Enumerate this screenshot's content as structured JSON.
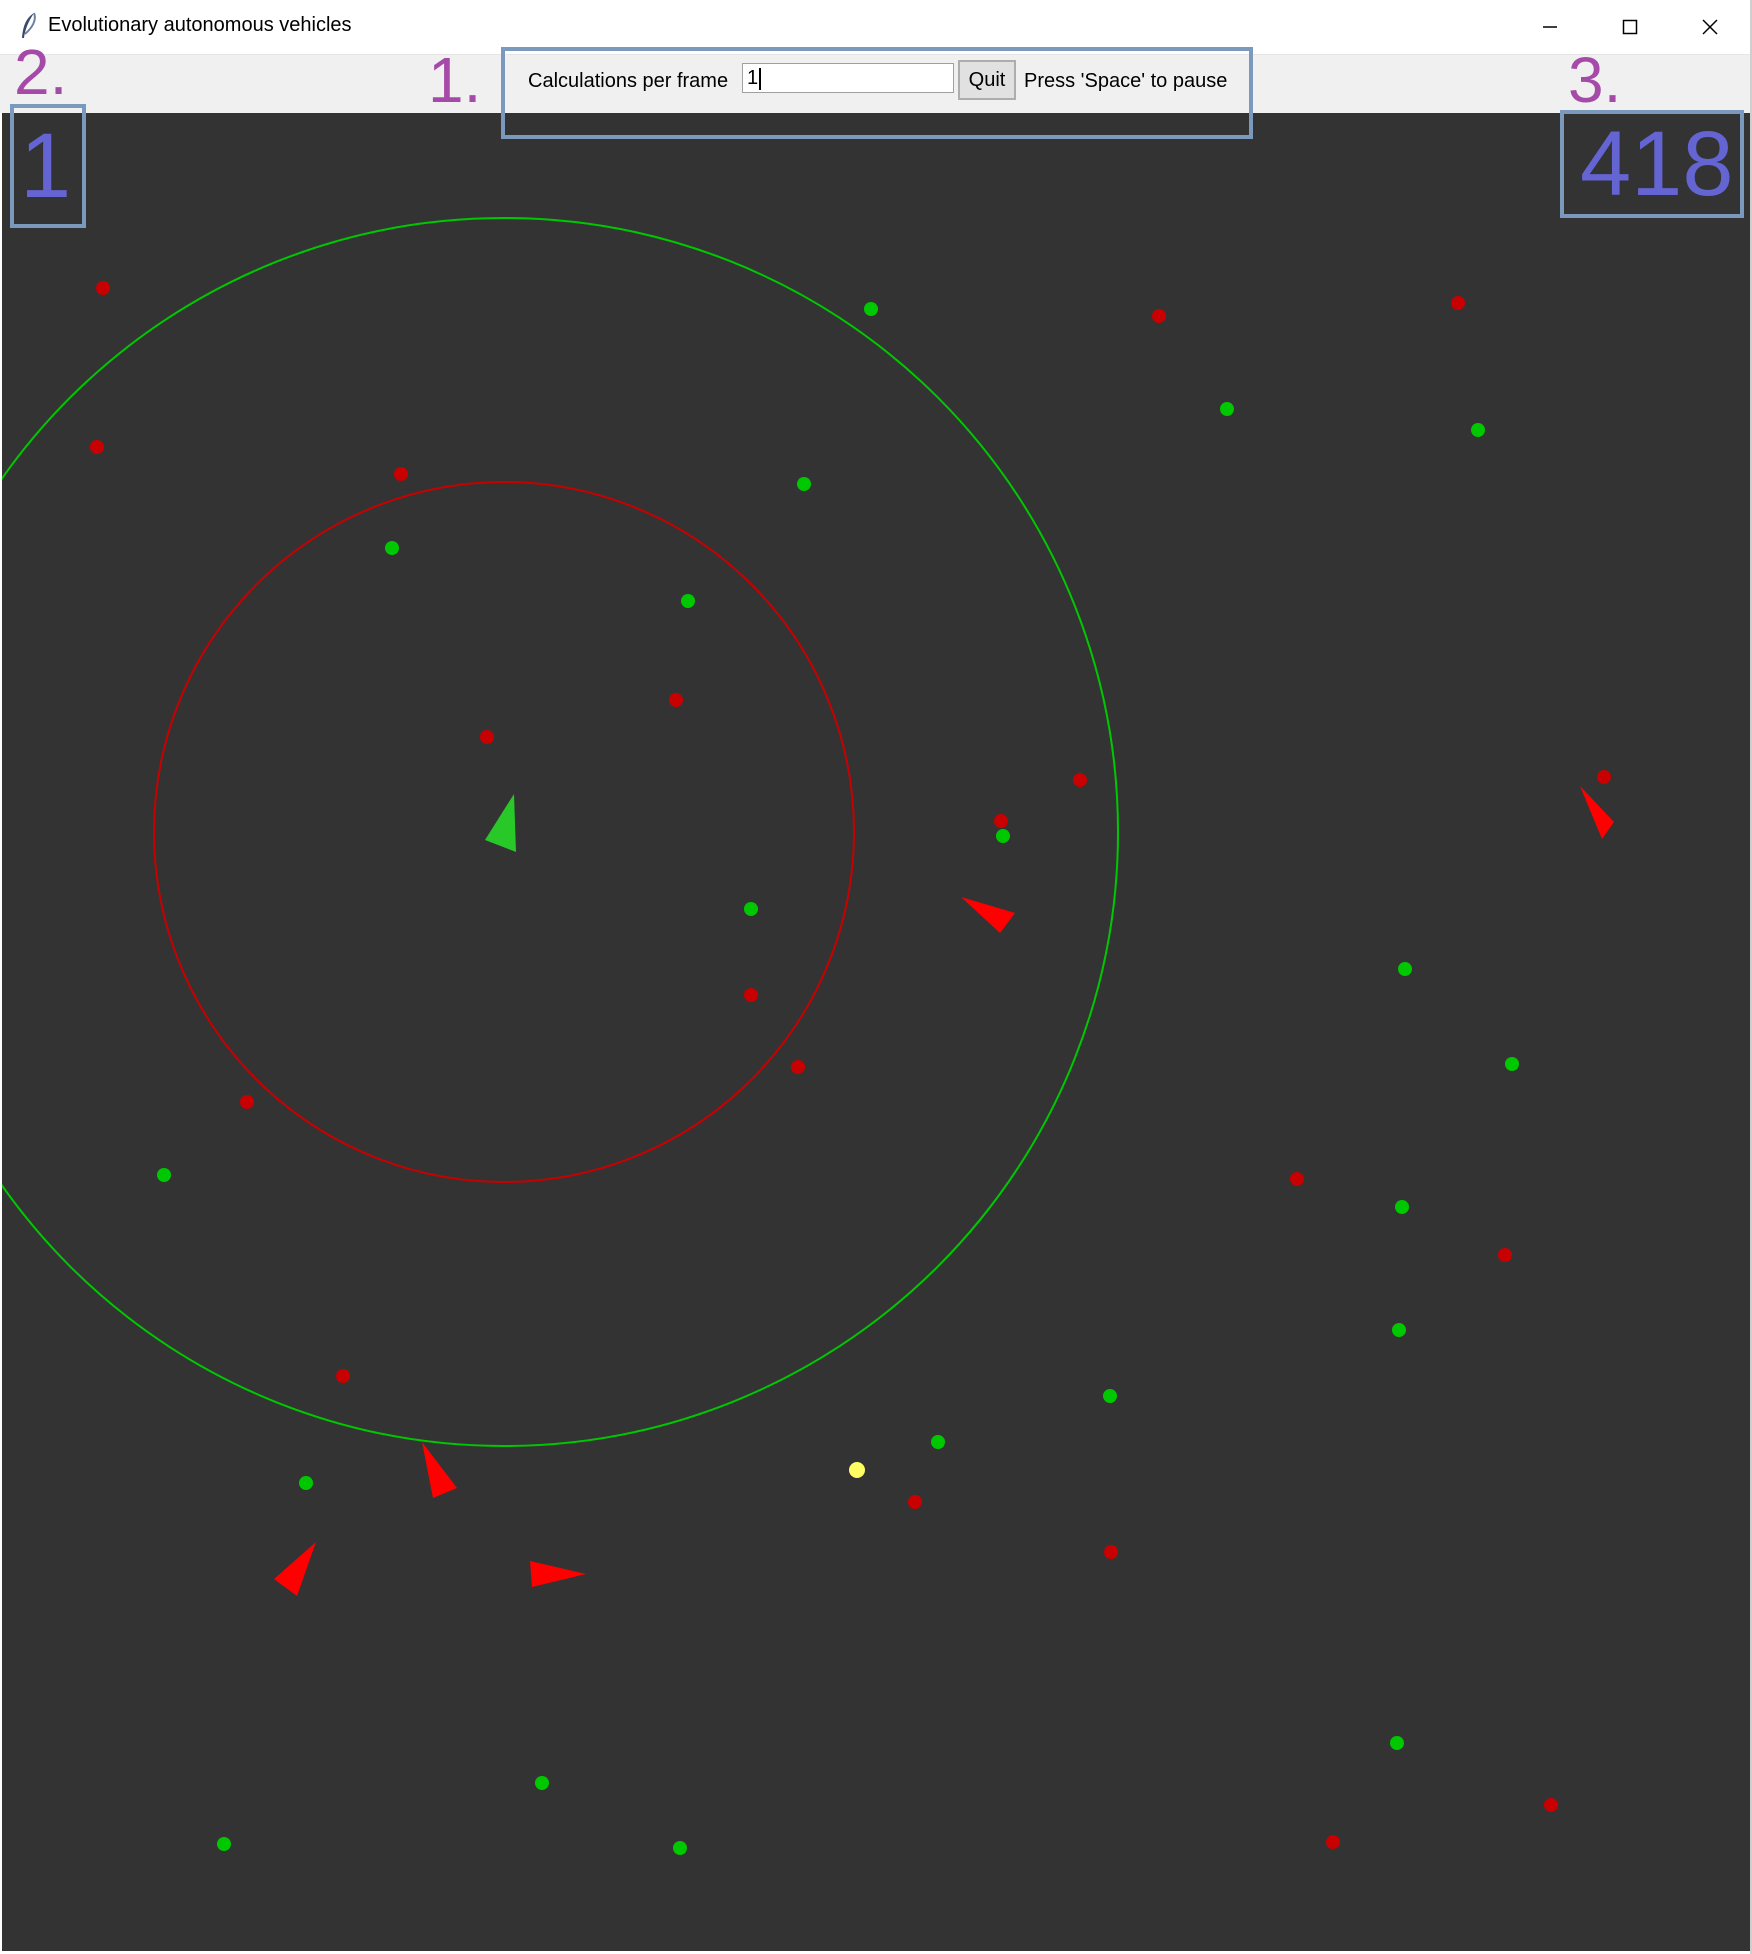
{
  "window": {
    "title": "Evolutionary autonomous vehicles",
    "icon": "feather-icon",
    "controls": [
      "minimize-icon",
      "maximize-icon",
      "close-icon"
    ]
  },
  "toolbar": {
    "calc_label": "Calculations per frame",
    "calc_value": "1",
    "quit_label": "Quit",
    "hint": "Press 'Space' to pause"
  },
  "annotations": {
    "toolbar_marker": "1.",
    "generation_marker": "2.",
    "count_marker": "3."
  },
  "counters": {
    "generation": "1",
    "frame_count": "418"
  },
  "colors": {
    "background": "#333333",
    "food": "#00c800",
    "poison": "#c80000",
    "yellow_item": "#ffff64",
    "vehicle_red": "#ff0000",
    "vehicle_green": "#28c828",
    "annotation_box": "#7b98bd",
    "annotation_number": "#a54aa8",
    "counter_text": "#6464d2"
  }
}
